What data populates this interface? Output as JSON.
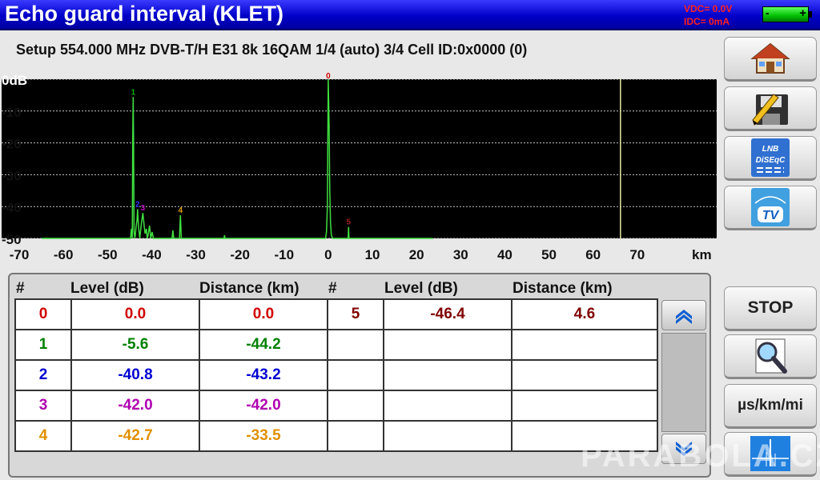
{
  "title": "Echo guard interval (KLET)",
  "status": {
    "vdc": "VDC= 0.0V",
    "idc": "IDC=  0mA"
  },
  "battery": {
    "minus": "-",
    "plus": "+"
  },
  "setup": "Setup  554.000 MHz  DVB-T/H  E31  8k 16QAM 1/4 (auto) 3/4  Cell ID:0x0000 (0)",
  "chart_data": {
    "type": "line",
    "xlabel": "km",
    "ylabel": "",
    "ylim": [
      -50,
      0
    ],
    "xlim": [
      -74,
      88
    ],
    "yticks": [
      "0dB",
      "-10",
      "-20",
      "-30",
      "-40",
      "-50"
    ],
    "xticks": [
      "-70",
      "-60",
      "-50",
      "-40",
      "-30",
      "-20",
      "-10",
      "0",
      "10",
      "20",
      "30",
      "40",
      "50",
      "60",
      "70"
    ],
    "grid": true,
    "guard_marker_km": 66.2,
    "series": [
      {
        "values": [
          [
            -64.9,
            -50
          ],
          [
            -44.8,
            -50
          ],
          [
            -44.6,
            -47
          ],
          [
            -44.4,
            -50
          ],
          [
            -44.3,
            -20
          ],
          [
            -44.2,
            -5.6
          ],
          [
            -44.1,
            -20
          ],
          [
            -44.0,
            -48
          ],
          [
            -43.8,
            -50
          ],
          [
            -43.5,
            -46
          ],
          [
            -43.3,
            -44
          ],
          [
            -43.2,
            -40.8
          ],
          [
            -43.0,
            -46
          ],
          [
            -42.7,
            -50
          ],
          [
            -42.3,
            -45
          ],
          [
            -42.0,
            -42.0
          ],
          [
            -41.7,
            -46
          ],
          [
            -41.5,
            -48.5
          ],
          [
            -41.2,
            -47
          ],
          [
            -41.0,
            -50
          ],
          [
            -40.8,
            -49
          ],
          [
            -40.5,
            -46
          ],
          [
            -40.2,
            -50
          ],
          [
            -39.9,
            -48
          ],
          [
            -39.6,
            -50
          ],
          [
            -35.4,
            -50
          ],
          [
            -35.2,
            -47.5
          ],
          [
            -35.0,
            -50
          ],
          [
            -33.7,
            -50
          ],
          [
            -33.5,
            -42.7
          ],
          [
            -33.3,
            -50
          ],
          [
            -23.6,
            -50
          ],
          [
            -23.5,
            -49
          ],
          [
            -23.4,
            -50
          ],
          [
            -0.6,
            -50
          ],
          [
            -0.4,
            -48
          ],
          [
            -0.2,
            -40
          ],
          [
            0.0,
            0.0
          ],
          [
            0.2,
            -15
          ],
          [
            0.35,
            -35
          ],
          [
            0.5,
            -45
          ],
          [
            0.7,
            -49
          ],
          [
            1.0,
            -50
          ],
          [
            4.5,
            -50
          ],
          [
            4.6,
            -46.4
          ],
          [
            4.7,
            -50
          ],
          [
            23.7,
            -50
          ]
        ]
      }
    ],
    "peaks": [
      {
        "label": "0",
        "x": 0.0,
        "y": 0.0,
        "color": "#d00000"
      },
      {
        "label": "1",
        "x": -44.2,
        "y": -5.6,
        "color": "#00b000"
      },
      {
        "label": "2",
        "x": -43.2,
        "y": -40.8,
        "color": "#3030ff"
      },
      {
        "label": "3",
        "x": -42.0,
        "y": -42.0,
        "color": "#c000c0"
      },
      {
        "label": "4",
        "x": -33.5,
        "y": -42.7,
        "color": "#e0a000"
      },
      {
        "label": "5",
        "x": 4.6,
        "y": -46.4,
        "color": "#a02020"
      }
    ],
    "trace_color": "#40e040",
    "marker_color": "#e8e8a0"
  },
  "table": {
    "headers": {
      "num": "#",
      "level": "Level (dB)",
      "distance": "Distance (km)"
    },
    "rows": [
      {
        "left": {
          "num": "0",
          "level": "0.0",
          "distance": "0.0",
          "color": "#d00000"
        },
        "right": {
          "num": "5",
          "level": "-46.4",
          "distance": "4.6",
          "color": "#800000"
        }
      },
      {
        "left": {
          "num": "1",
          "level": "-5.6",
          "distance": "-44.2",
          "color": "#008000"
        },
        "right": {
          "num": "",
          "level": "",
          "distance": "",
          "color": "#000000"
        }
      },
      {
        "left": {
          "num": "2",
          "level": "-40.8",
          "distance": "-43.2",
          "color": "#0000d0"
        },
        "right": {
          "num": "",
          "level": "",
          "distance": "",
          "color": "#000000"
        }
      },
      {
        "left": {
          "num": "3",
          "level": "-42.0",
          "distance": "-42.0",
          "color": "#b000b0"
        },
        "right": {
          "num": "",
          "level": "",
          "distance": "",
          "color": "#000000"
        }
      },
      {
        "left": {
          "num": "4",
          "level": "-42.7",
          "distance": "-33.5",
          "color": "#e09000"
        },
        "right": {
          "num": "",
          "level": "",
          "distance": "",
          "color": "#000000"
        }
      }
    ]
  },
  "sidebar": {
    "home_icon": "home-icon",
    "save_icon": "save-pencil-icon",
    "lnb": {
      "line1": "LNB",
      "line2": "DiSEqC"
    },
    "tv": {
      "label": "TV"
    },
    "stop_label": "STOP",
    "zoom_icon": "magnifier-icon",
    "units_label": "µs/km/mi",
    "spectrum_icon": "spectrum-icon"
  },
  "watermark": "PARABOLA.CZ"
}
